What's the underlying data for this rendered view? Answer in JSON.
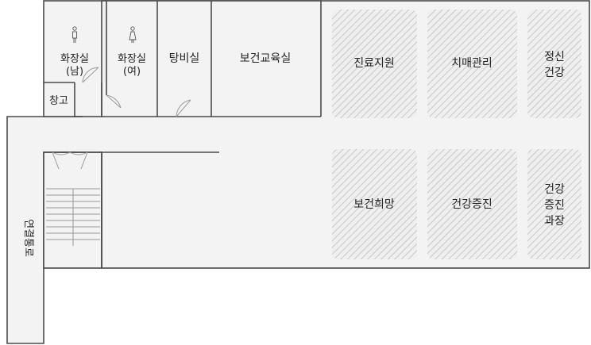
{
  "colors": {
    "background": "#ffffff",
    "floor": "#f3f3f3",
    "wall": "#4a4a4a",
    "zone_fill": "#efefef",
    "hatch": "#c8c8c8",
    "text": "#222222"
  },
  "rooms": {
    "restroom_men": {
      "label_line1": "화장실",
      "label_line2": "(남)",
      "icon": "male-person-icon"
    },
    "restroom_women": {
      "label_line1": "화장실",
      "label_line2": "(여)",
      "icon": "female-person-icon"
    },
    "storage": {
      "label": "창고"
    },
    "water_room": {
      "label": "탕비실"
    },
    "health_education": {
      "label": "보건교육실"
    },
    "corridor": {
      "label": "연결통로"
    }
  },
  "zones": [
    {
      "lines": [
        "진료지원"
      ]
    },
    {
      "lines": [
        "치매관리"
      ]
    },
    {
      "lines": [
        "정신",
        "건강"
      ]
    },
    {
      "lines": [
        "보건희망"
      ]
    },
    {
      "lines": [
        "건강증진"
      ]
    },
    {
      "lines": [
        "건강",
        "증진",
        "과장"
      ]
    }
  ]
}
